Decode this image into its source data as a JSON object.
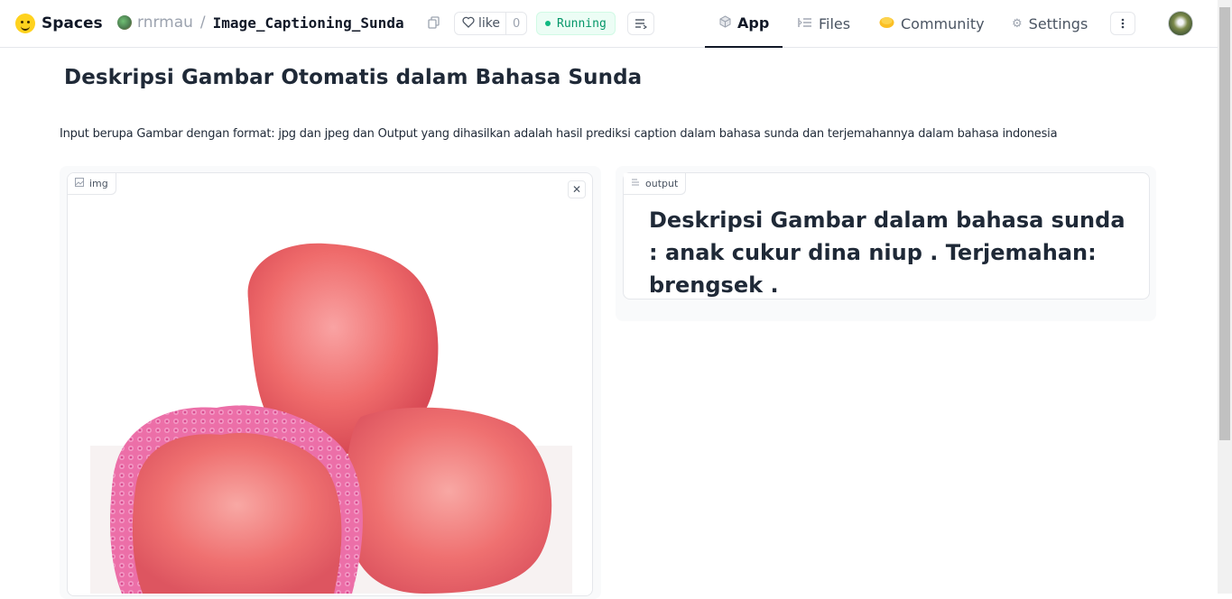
{
  "header": {
    "brand": "Spaces",
    "owner": "rnrmau",
    "separator": "/",
    "repo": "Image_Captioning_Sunda",
    "like_label": "like",
    "like_count": "0",
    "status": "Running",
    "tabs": [
      {
        "label": "App",
        "icon": "cube-icon",
        "active": true
      },
      {
        "label": "Files",
        "icon": "files-icon",
        "active": false
      },
      {
        "label": "Community",
        "icon": "community-icon",
        "active": false
      },
      {
        "label": "Settings",
        "icon": "gear-icon",
        "active": false
      }
    ]
  },
  "main": {
    "title": "Deskripsi Gambar Otomatis dalam Bahasa Sunda",
    "description": "Input berupa Gambar dengan format: jpg dan jpeg dan Output yang dihasilkan adalah hasil prediksi caption dalam bahasa sunda dan terjemahannya dalam bahasa indonesia",
    "input_label": "img",
    "output_label": "output",
    "output_text": "Deskripsi Gambar dalam bahasa sunda : anak cukur dina niup . Terjemahan: brengsek ."
  },
  "colors": {
    "accent_running": "#10b981",
    "apple": "#ee5a5a",
    "net": "#e94b9f"
  }
}
